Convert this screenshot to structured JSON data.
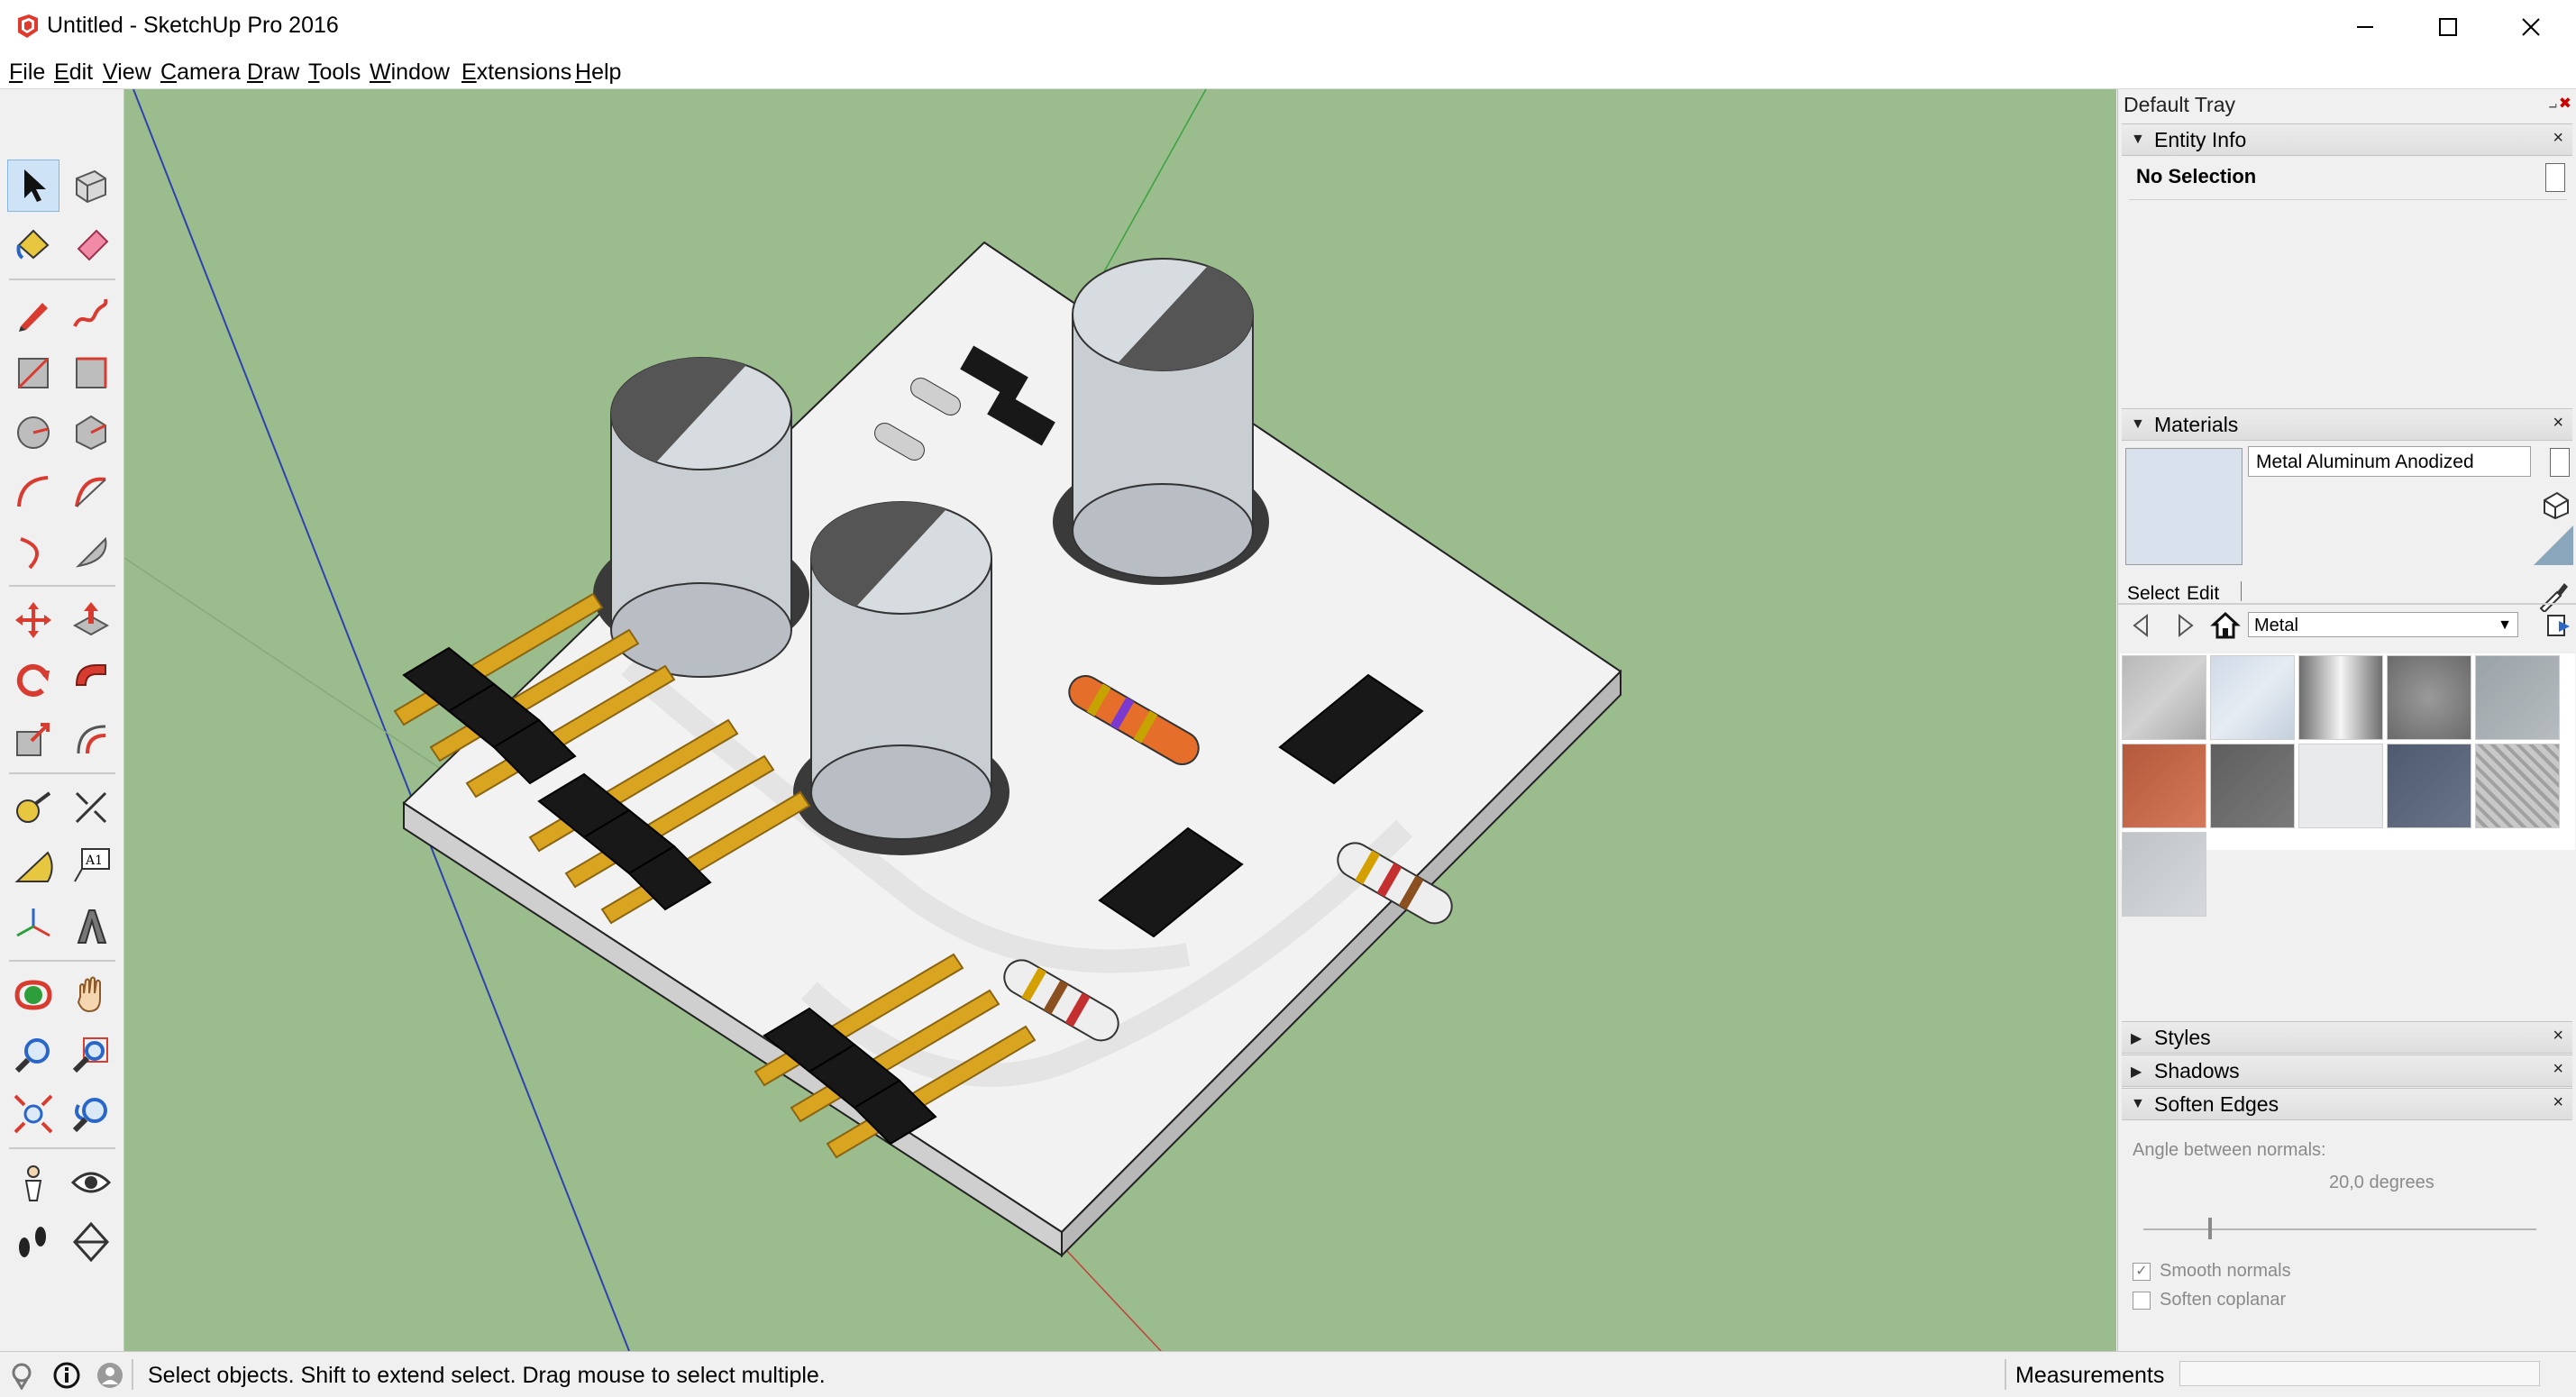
{
  "window": {
    "title": "Untitled - SketchUp Pro 2016",
    "minimize": "—",
    "maximize": "☐",
    "close": "✕"
  },
  "menu": {
    "items": [
      {
        "u": "F",
        "rest": "ile"
      },
      {
        "u": "E",
        "rest": "dit"
      },
      {
        "u": "V",
        "rest": "iew"
      },
      {
        "u": "C",
        "rest": "amera"
      },
      {
        "u": "D",
        "rest": "raw"
      },
      {
        "u": "T",
        "rest": "ools"
      },
      {
        "u": "W",
        "rest": "indow"
      },
      {
        "u": "E",
        "rest": "xtensions"
      },
      {
        "u": "H",
        "rest": "elp"
      }
    ]
  },
  "toolbar": {
    "text_tool_label": "A1"
  },
  "tray": {
    "title": "Default Tray",
    "pin": "⨼",
    "close": "✖",
    "entity_info": {
      "title": "Entity Info",
      "selection": "No Selection"
    },
    "materials": {
      "title": "Materials",
      "material_name": "Metal Aluminum Anodized",
      "tab_select": "Select",
      "tab_edit": "Edit",
      "library": "Metal"
    },
    "styles": {
      "title": "Styles"
    },
    "shadows": {
      "title": "Shadows"
    },
    "soften_edges": {
      "title": "Soften Edges",
      "angle_label": "Angle between normals:",
      "angle_value": "20,0  degrees",
      "angle_fraction": 0.17,
      "smooth_normals": "Smooth normals",
      "soften_coplanar": "Soften coplanar"
    },
    "panel_close": "×"
  },
  "status": {
    "hint": "Select objects. Shift to extend select. Drag mouse to select multiple.",
    "measurements_label": "Measurements",
    "measurements_value": ""
  },
  "colors": {
    "viewport_bg": "#9bbd8e",
    "selection_blue": "#cfe3f7",
    "pcb_white": "#f2f2f2",
    "pin_gold": "#d9a520",
    "capacitor_silver": "#c9ced3"
  }
}
